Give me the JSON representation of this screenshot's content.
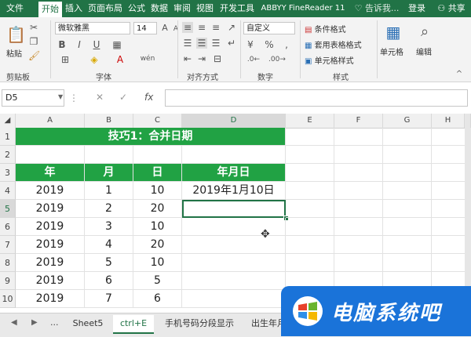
{
  "ribbon_tabs": [
    "文件",
    "开始",
    "插入",
    "页面布局",
    "公式",
    "数据",
    "审阅",
    "视图",
    "开发工具",
    "ABBYY FineReader 11"
  ],
  "tell_me": "告诉我...",
  "login": "登录",
  "share": "共享",
  "clipboard": {
    "paste": "粘贴",
    "group": "剪贴板"
  },
  "font": {
    "name": "微软雅黑",
    "size": "14",
    "bold": "B",
    "italic": "I",
    "underline": "U",
    "grow": "A",
    "shrink": "A",
    "group": "字体",
    "phonetic": "wén"
  },
  "alignment": {
    "group": "对齐方式"
  },
  "number": {
    "format": "自定义",
    "group": "数字"
  },
  "styles": {
    "conditional": "条件格式",
    "table": "套用表格格式",
    "cell_styles": "单元格样式",
    "group": "样式"
  },
  "cells": {
    "label": "单元格"
  },
  "editing": {
    "label": "编辑"
  },
  "formula_bar": {
    "name_box": "D5",
    "cancel": "✕",
    "enter": "✓",
    "fx": "fx",
    "content": ""
  },
  "columns": [
    "A",
    "B",
    "C",
    "D",
    "E",
    "F",
    "G",
    "H"
  ],
  "rows": [
    "1",
    "2",
    "3",
    "4",
    "5",
    "6",
    "7",
    "8",
    "9",
    "10"
  ],
  "sheet": {
    "title": "技巧1：合并日期",
    "headers": [
      "年",
      "月",
      "日",
      "年月日"
    ],
    "data": [
      [
        "2019",
        "1",
        "10",
        "2019年1月10日"
      ],
      [
        "2019",
        "2",
        "20",
        ""
      ],
      [
        "2019",
        "3",
        "10",
        ""
      ],
      [
        "2019",
        "4",
        "20",
        ""
      ],
      [
        "2019",
        "5",
        "10",
        ""
      ],
      [
        "2019",
        "6",
        "5",
        ""
      ],
      [
        "2019",
        "7",
        "6",
        ""
      ]
    ]
  },
  "sheet_tabs": {
    "ellipsis": "...",
    "tabs": [
      "Sheet5",
      "ctrl+E",
      "手机号码分段显示",
      "出生年月"
    ],
    "active": 1
  },
  "watermark": {
    "text": "电脑系统吧"
  },
  "colors": {
    "excel_green": "#217346",
    "header_green": "#21a244",
    "watermark_blue": "#1a73d9"
  }
}
